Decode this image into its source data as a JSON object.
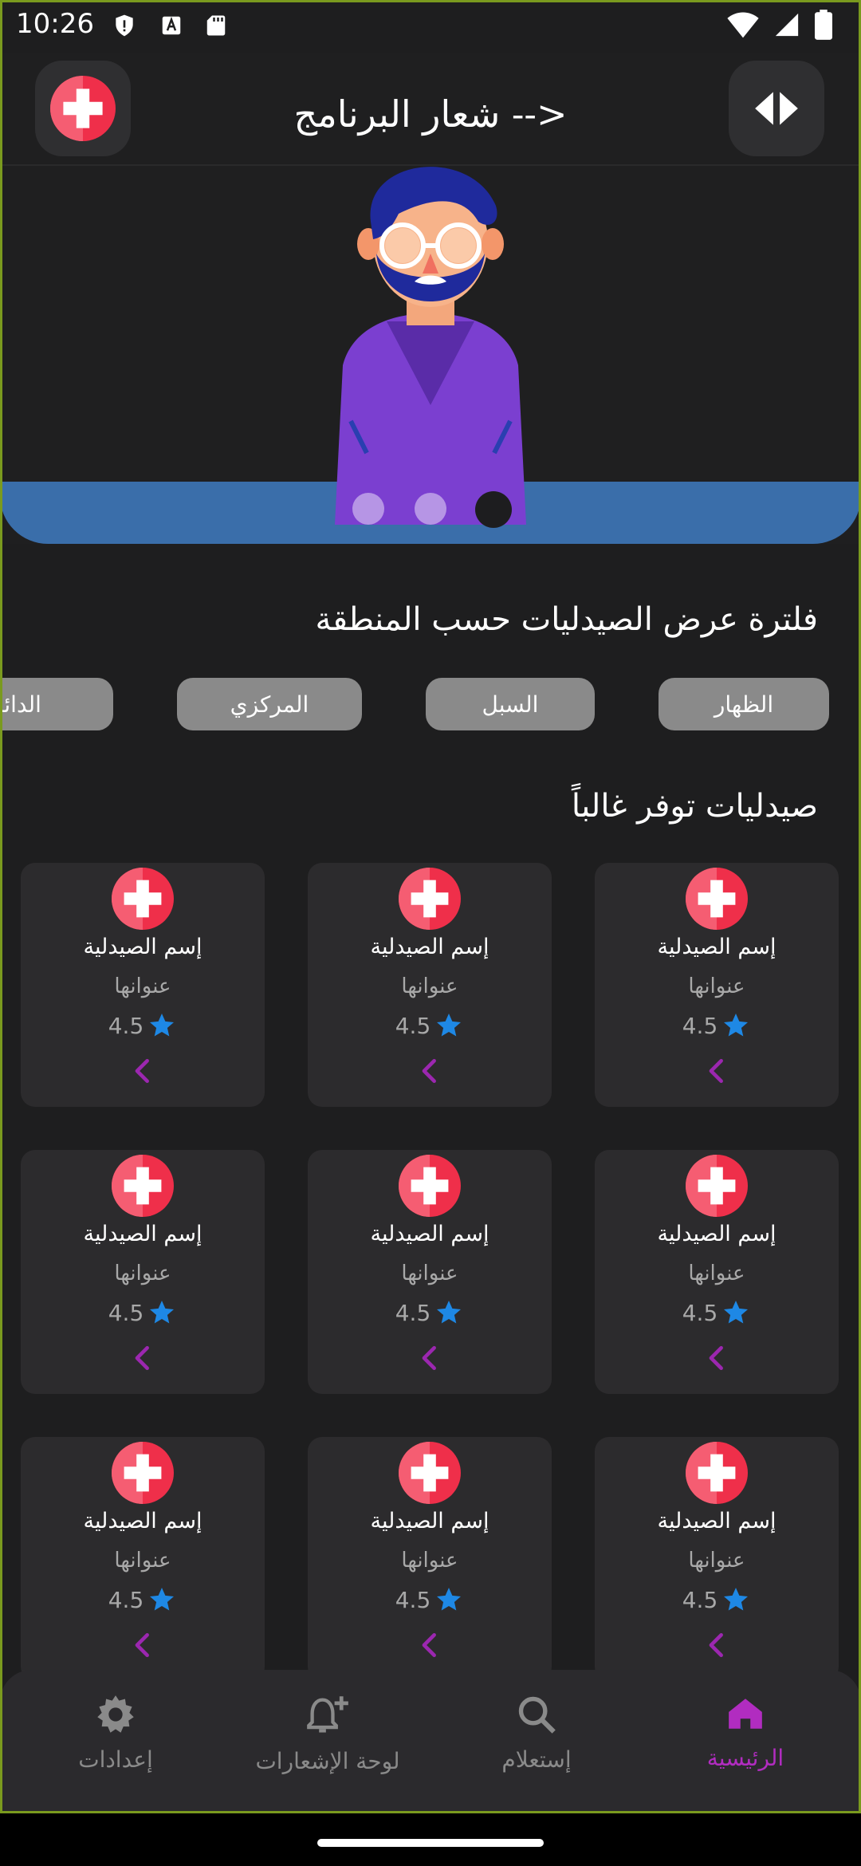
{
  "status_bar": {
    "time": "10:26"
  },
  "app_bar": {
    "title": "شعار البرنامج -->",
    "logo_icon": "medical-cross-icon",
    "toggle_icon": "code-arrows-icon"
  },
  "banner": {
    "active_slide": 3,
    "slide_count": 3,
    "image": "doctor-illustration"
  },
  "filter": {
    "title": "فلترة عرض الصيدليات حسب المنطقة",
    "chips": [
      "الظهار",
      "السبل",
      "المركزي",
      "الدائري"
    ]
  },
  "frequent": {
    "title": "صيدليات توفر غالباً",
    "cards": [
      {
        "name": "إسم الصيدلية",
        "address": "عنوانها",
        "rating": "4.5"
      },
      {
        "name": "إسم الصيدلية",
        "address": "عنوانها",
        "rating": "4.5"
      },
      {
        "name": "إسم الصيدلية",
        "address": "عنوانها",
        "rating": "4.5"
      },
      {
        "name": "إسم الصيدلية",
        "address": "عنوانها",
        "rating": "4.5"
      },
      {
        "name": "إسم الصيدلية",
        "address": "عنوانها",
        "rating": "4.5"
      },
      {
        "name": "إسم الصيدلية",
        "address": "عنوانها",
        "rating": "4.5"
      },
      {
        "name": "إسم الصيدلية",
        "address": "عنوانها",
        "rating": "4.5"
      },
      {
        "name": "إسم الصيدلية",
        "address": "عنوانها",
        "rating": "4.5"
      },
      {
        "name": "إسم الصيدلية",
        "address": "عنوانها",
        "rating": "4.5"
      }
    ]
  },
  "bottom_nav": {
    "items": [
      {
        "label": "الرئيسية",
        "icon": "home-icon",
        "active": true
      },
      {
        "label": "إستعلام",
        "icon": "search-icon",
        "active": false
      },
      {
        "label": "لوحة الإشعارات",
        "icon": "bell-plus-icon",
        "active": false
      },
      {
        "label": "إعدادات",
        "icon": "gear-icon",
        "active": false
      }
    ]
  },
  "colors": {
    "accent": "#b12cc0",
    "star": "#1e88e5",
    "chevron": "#9c27b0",
    "logo_red": "#ef2f4a",
    "banner_band": "#3a6eaa"
  }
}
